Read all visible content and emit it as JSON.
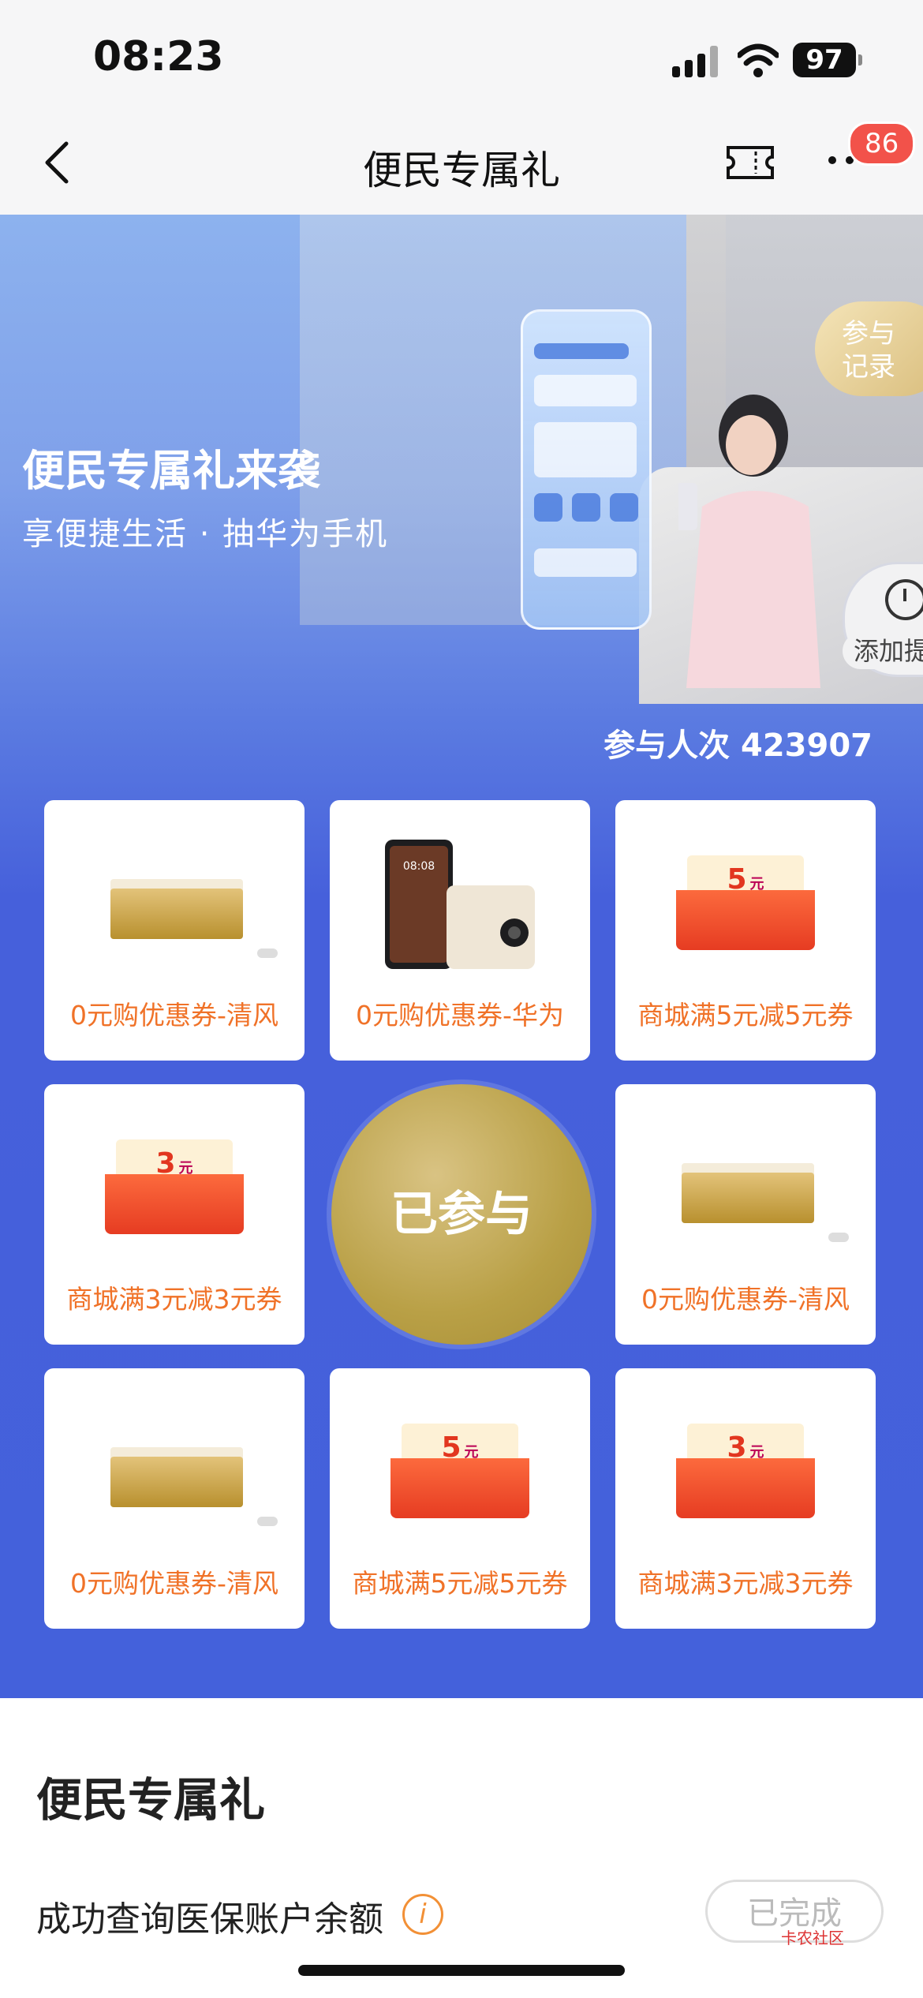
{
  "status": {
    "time": "08:23",
    "battery": "97"
  },
  "nav": {
    "title": "便民专属礼",
    "badge": "86"
  },
  "hero": {
    "title": "便民专属礼来袭",
    "subtitle": "享便捷生活 · 抽华为手机",
    "record_label": "参与\n记录",
    "remind_label": "添加提"
  },
  "participation": {
    "label": "参与人次 423907"
  },
  "grid": {
    "items": [
      {
        "label": "0元购优惠券-清风",
        "kind": "tissue"
      },
      {
        "label": "0元购优惠券-华为",
        "kind": "phone"
      },
      {
        "label": "商城满5元减5元券",
        "kind": "coupon",
        "value": "5",
        "unit": "元"
      },
      {
        "label": "商城满3元减3元券",
        "kind": "coupon",
        "value": "3",
        "unit": "元"
      },
      {
        "label": "0元购优惠券-清风",
        "kind": "tissue"
      },
      {
        "label": "0元购优惠券-清风",
        "kind": "tissue"
      },
      {
        "label": "商城满5元减5元券",
        "kind": "coupon",
        "value": "5",
        "unit": "元"
      },
      {
        "label": "商城满3元减3元券",
        "kind": "coupon",
        "value": "3",
        "unit": "元"
      }
    ],
    "center_label": "已参与"
  },
  "section": {
    "title": "便民专属礼",
    "task_label": "成功查询医保账户余额",
    "task_status": "已完成",
    "watermark": "卡农社区"
  },
  "colors": {
    "hero_blue": "#4461db",
    "accent_orange": "#f07228",
    "gold": "#b9a046"
  }
}
